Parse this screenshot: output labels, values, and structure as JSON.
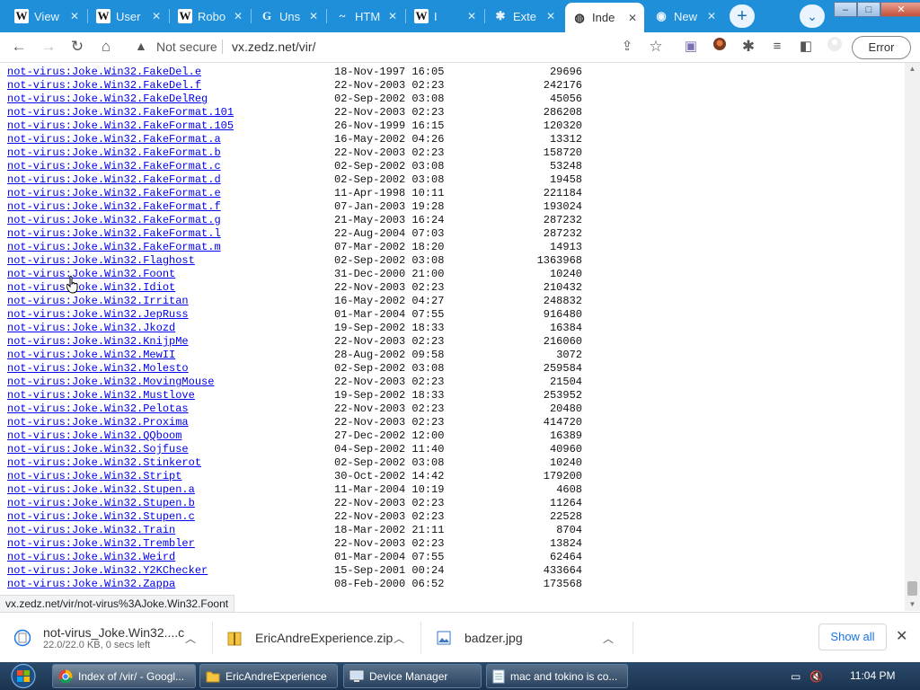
{
  "tabs": [
    {
      "title": "View",
      "icon": "W",
      "icon_name": "wikipedia-icon"
    },
    {
      "title": "User",
      "icon": "W",
      "icon_name": "wikipedia-icon"
    },
    {
      "title": "Robo",
      "icon": "W",
      "icon_name": "wikipedia-icon"
    },
    {
      "title": "Uns",
      "icon": "G",
      "icon_name": "site-globe-icon"
    },
    {
      "title": "HTM",
      "icon": "~",
      "icon_name": "rainbow-icon"
    },
    {
      "title": "I",
      "icon": "W",
      "icon_name": "wikipedia-icon"
    },
    {
      "title": "Exte",
      "icon": "✱",
      "icon_name": "extension-puzzle-icon"
    },
    {
      "title": "Inde",
      "icon": "◍",
      "icon_name": "globe-icon",
      "active": true
    },
    {
      "title": "New",
      "icon": "◉",
      "icon_name": "chrome-icon"
    }
  ],
  "toolbar": {
    "not_secure": "Not secure",
    "url": "vx.zedz.net/vir/",
    "error_label": "Error"
  },
  "listing": [
    {
      "name": "not-virus:Joke.Win32.FakeDel.e",
      "date": "18-Nov-1997 16:05",
      "size": "29696"
    },
    {
      "name": "not-virus:Joke.Win32.FakeDel.f",
      "date": "22-Nov-2003 02:23",
      "size": "242176"
    },
    {
      "name": "not-virus:Joke.Win32.FakeDelReg",
      "date": "02-Sep-2002 03:08",
      "size": "45056"
    },
    {
      "name": "not-virus:Joke.Win32.FakeFormat.101",
      "date": "22-Nov-2003 02:23",
      "size": "286208"
    },
    {
      "name": "not-virus:Joke.Win32.FakeFormat.105",
      "date": "26-Nov-1999 16:15",
      "size": "120320"
    },
    {
      "name": "not-virus:Joke.Win32.FakeFormat.a",
      "date": "16-May-2002 04:26",
      "size": "13312"
    },
    {
      "name": "not-virus:Joke.Win32.FakeFormat.b",
      "date": "22-Nov-2003 02:23",
      "size": "158720"
    },
    {
      "name": "not-virus:Joke.Win32.FakeFormat.c",
      "date": "02-Sep-2002 03:08",
      "size": "53248"
    },
    {
      "name": "not-virus:Joke.Win32.FakeFormat.d",
      "date": "02-Sep-2002 03:08",
      "size": "19458"
    },
    {
      "name": "not-virus:Joke.Win32.FakeFormat.e",
      "date": "11-Apr-1998 10:11",
      "size": "221184"
    },
    {
      "name": "not-virus:Joke.Win32.FakeFormat.f",
      "date": "07-Jan-2003 19:28",
      "size": "193024"
    },
    {
      "name": "not-virus:Joke.Win32.FakeFormat.g",
      "date": "21-May-2003 16:24",
      "size": "287232"
    },
    {
      "name": "not-virus:Joke.Win32.FakeFormat.l",
      "date": "22-Aug-2004 07:03",
      "size": "287232"
    },
    {
      "name": "not-virus:Joke.Win32.FakeFormat.m",
      "date": "07-Mar-2002 18:20",
      "size": "14913"
    },
    {
      "name": "not-virus:Joke.Win32.Flaghost",
      "date": "02-Sep-2002 03:08",
      "size": "1363968"
    },
    {
      "name": "not-virus:Joke.Win32.Foont",
      "date": "31-Dec-2000 21:00",
      "size": "10240"
    },
    {
      "name": "not-virus:Joke.Win32.Idiot",
      "date": "22-Nov-2003 02:23",
      "size": "210432"
    },
    {
      "name": "not-virus:Joke.Win32.Irritan",
      "date": "16-May-2002 04:27",
      "size": "248832"
    },
    {
      "name": "not-virus:Joke.Win32.JepRuss",
      "date": "01-Mar-2004 07:55",
      "size": "916480"
    },
    {
      "name": "not-virus:Joke.Win32.Jkozd",
      "date": "19-Sep-2002 18:33",
      "size": "16384"
    },
    {
      "name": "not-virus:Joke.Win32.KnijpMe",
      "date": "22-Nov-2003 02:23",
      "size": "216060"
    },
    {
      "name": "not-virus:Joke.Win32.MewII",
      "date": "28-Aug-2002 09:58",
      "size": "3072"
    },
    {
      "name": "not-virus:Joke.Win32.Molesto",
      "date": "02-Sep-2002 03:08",
      "size": "259584"
    },
    {
      "name": "not-virus:Joke.Win32.MovingMouse",
      "date": "22-Nov-2003 02:23",
      "size": "21504"
    },
    {
      "name": "not-virus:Joke.Win32.Mustlove",
      "date": "19-Sep-2002 18:33",
      "size": "253952"
    },
    {
      "name": "not-virus:Joke.Win32.Pelotas",
      "date": "22-Nov-2003 02:23",
      "size": "20480"
    },
    {
      "name": "not-virus:Joke.Win32.Proxima",
      "date": "22-Nov-2003 02:23",
      "size": "414720"
    },
    {
      "name": "not-virus:Joke.Win32.QQboom",
      "date": "27-Dec-2002 12:00",
      "size": "16389"
    },
    {
      "name": "not-virus:Joke.Win32.Sojfuse",
      "date": "04-Sep-2002 11:40",
      "size": "40960"
    },
    {
      "name": "not-virus:Joke.Win32.Stinkerot",
      "date": "02-Sep-2002 03:08",
      "size": "10240"
    },
    {
      "name": "not-virus:Joke.Win32.Stript",
      "date": "30-Oct-2002 14:42",
      "size": "179200"
    },
    {
      "name": "not-virus:Joke.Win32.Stupen.a",
      "date": "11-Mar-2004 10:19",
      "size": "4608"
    },
    {
      "name": "not-virus:Joke.Win32.Stupen.b",
      "date": "22-Nov-2003 02:23",
      "size": "11264"
    },
    {
      "name": "not-virus:Joke.Win32.Stupen.c",
      "date": "22-Nov-2003 02:23",
      "size": "22528"
    },
    {
      "name": "not-virus:Joke.Win32.Train",
      "date": "18-Mar-2002 21:11",
      "size": "8704"
    },
    {
      "name": "not-virus:Joke.Win32.Trembler",
      "date": "22-Nov-2003 02:23",
      "size": "13824"
    },
    {
      "name": "not-virus:Joke.Win32.Weird",
      "date": "01-Mar-2004 07:55",
      "size": "62464"
    },
    {
      "name": "not-virus:Joke.Win32.Y2KChecker",
      "date": "15-Sep-2001 00:24",
      "size": "433664"
    },
    {
      "name": "not-virus:Joke.Win32.Zappa",
      "date": "08-Feb-2000 06:52",
      "size": "173568"
    }
  ],
  "status_url": "vx.zedz.net/vir/not-virus%3AJoke.Win32.Foont",
  "downloads": {
    "items": [
      {
        "name": "not-virus_Joke.Win32....c",
        "status": "22.0/22.0 KB, 0 secs left",
        "icon_name": "file-icon"
      },
      {
        "name": "EricAndreExperience.zip",
        "status": "",
        "icon_name": "zip-file-icon"
      },
      {
        "name": "badzer.jpg",
        "status": "",
        "icon_name": "image-file-icon"
      }
    ],
    "show_all": "Show all"
  },
  "taskbar": {
    "tasks": [
      {
        "label": "Index of /vir/ - Googl...",
        "icon_name": "chrome-icon",
        "active": true
      },
      {
        "label": "EricAndreExperience",
        "icon_name": "folder-icon"
      },
      {
        "label": "Device Manager",
        "icon_name": "device-manager-icon"
      },
      {
        "label": "mac and tokino is co...",
        "icon_name": "notepad-icon"
      }
    ],
    "clock": "11:04 PM"
  },
  "colors": {
    "tabstrip": "#1e8fd8",
    "link": "#0000ee",
    "taskbar": "#1b3350"
  }
}
